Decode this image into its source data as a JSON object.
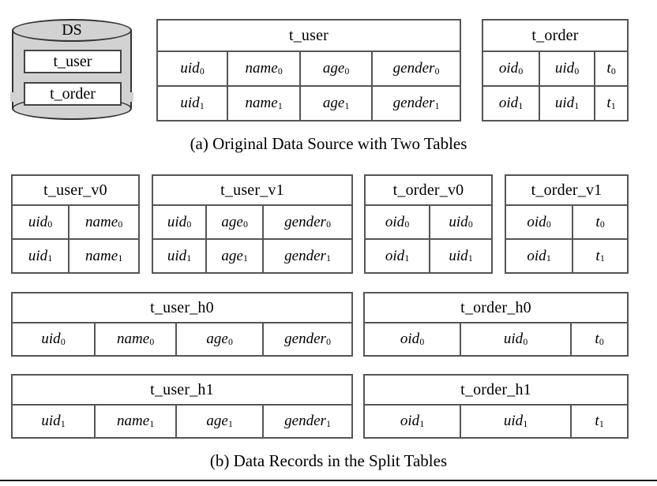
{
  "figure": {
    "captions": {
      "a": "(a) Original Data Source with Two Tables",
      "b": "(b) Data Records in the Split Tables"
    }
  },
  "data_source": {
    "label": "DS",
    "tables": [
      {
        "name": "t_user"
      },
      {
        "name": "t_order"
      }
    ]
  },
  "original_tables": [
    {
      "id": "t_user",
      "title": "t_user",
      "columns": [
        "uid",
        "name",
        "age",
        "gender"
      ],
      "rows": [
        [
          {
            "base": "uid",
            "sub": "0"
          },
          {
            "base": "name",
            "sub": "0"
          },
          {
            "base": "age",
            "sub": "0"
          },
          {
            "base": "gender",
            "sub": "0"
          }
        ],
        [
          {
            "base": "uid",
            "sub": "1"
          },
          {
            "base": "name",
            "sub": "1"
          },
          {
            "base": "age",
            "sub": "1"
          },
          {
            "base": "gender",
            "sub": "1"
          }
        ]
      ]
    },
    {
      "id": "t_order",
      "title": "t_order",
      "columns": [
        "oid",
        "uid",
        "t"
      ],
      "rows": [
        [
          {
            "base": "oid",
            "sub": "0"
          },
          {
            "base": "uid",
            "sub": "0"
          },
          {
            "base": "t",
            "sub": "0"
          }
        ],
        [
          {
            "base": "oid",
            "sub": "1"
          },
          {
            "base": "uid",
            "sub": "1"
          },
          {
            "base": "t",
            "sub": "1"
          }
        ]
      ]
    }
  ],
  "vertical_split_tables": [
    {
      "id": "t_user_v0",
      "title": "t_user_v0",
      "rows": [
        [
          {
            "base": "uid",
            "sub": "0"
          },
          {
            "base": "name",
            "sub": "0"
          }
        ],
        [
          {
            "base": "uid",
            "sub": "1"
          },
          {
            "base": "name",
            "sub": "1"
          }
        ]
      ]
    },
    {
      "id": "t_user_v1",
      "title": "t_user_v1",
      "rows": [
        [
          {
            "base": "uid",
            "sub": "0"
          },
          {
            "base": "age",
            "sub": "0"
          },
          {
            "base": "gender",
            "sub": "0"
          }
        ],
        [
          {
            "base": "uid",
            "sub": "1"
          },
          {
            "base": "age",
            "sub": "1"
          },
          {
            "base": "gender",
            "sub": "1"
          }
        ]
      ]
    },
    {
      "id": "t_order_v0",
      "title": "t_order_v0",
      "rows": [
        [
          {
            "base": "oid",
            "sub": "0"
          },
          {
            "base": "uid",
            "sub": "0"
          }
        ],
        [
          {
            "base": "oid",
            "sub": "1"
          },
          {
            "base": "uid",
            "sub": "1"
          }
        ]
      ]
    },
    {
      "id": "t_order_v1",
      "title": "t_order_v1",
      "rows": [
        [
          {
            "base": "oid",
            "sub": "0"
          },
          {
            "base": "t",
            "sub": "0"
          }
        ],
        [
          {
            "base": "oid",
            "sub": "1"
          },
          {
            "base": "t",
            "sub": "1"
          }
        ]
      ]
    }
  ],
  "horizontal_split_tables": [
    {
      "id": "t_user_h0",
      "title": "t_user_h0",
      "rows": [
        [
          {
            "base": "uid",
            "sub": "0"
          },
          {
            "base": "name",
            "sub": "0"
          },
          {
            "base": "age",
            "sub": "0"
          },
          {
            "base": "gender",
            "sub": "0"
          }
        ]
      ]
    },
    {
      "id": "t_order_h0",
      "title": "t_order_h0",
      "rows": [
        [
          {
            "base": "oid",
            "sub": "0"
          },
          {
            "base": "uid",
            "sub": "0"
          },
          {
            "base": "t",
            "sub": "0"
          }
        ]
      ]
    },
    {
      "id": "t_user_h1",
      "title": "t_user_h1",
      "rows": [
        [
          {
            "base": "uid",
            "sub": "1"
          },
          {
            "base": "name",
            "sub": "1"
          },
          {
            "base": "age",
            "sub": "1"
          },
          {
            "base": "gender",
            "sub": "1"
          }
        ]
      ]
    },
    {
      "id": "t_order_h1",
      "title": "t_order_h1",
      "rows": [
        [
          {
            "base": "oid",
            "sub": "1"
          },
          {
            "base": "uid",
            "sub": "1"
          },
          {
            "base": "t",
            "sub": "1"
          }
        ]
      ]
    }
  ],
  "colors": {
    "cylinder_fill": "#d2d2d2",
    "border": "#555555",
    "cylinder_border": "#333333",
    "text": "#000000",
    "background": "#ffffff"
  }
}
